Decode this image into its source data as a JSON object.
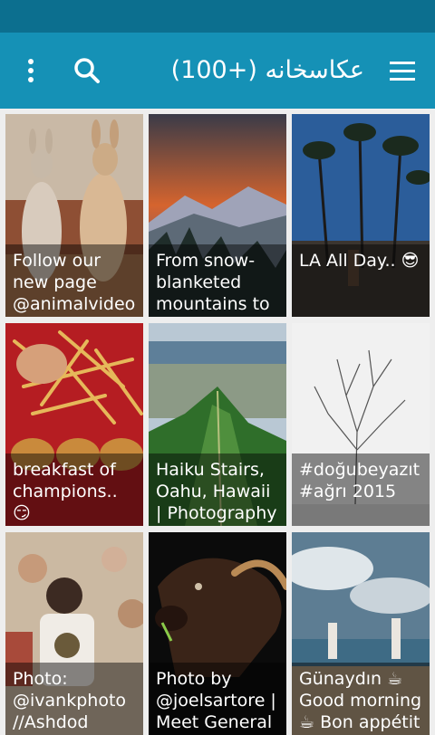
{
  "header": {
    "title": "عکاسخانه (+100)",
    "menu_icon": "hamburger-menu-icon",
    "search_icon": "search-icon",
    "overflow_icon": "overflow-menu-icon"
  },
  "colors": {
    "status_bar": "#0c6f8f",
    "app_bar": "#1591b6",
    "background": "#eeeeee"
  },
  "posts": [
    {
      "caption": "Follow our new page @animalvideo"
    },
    {
      "caption": "From snow-blanketed mountains to"
    },
    {
      "caption": "LA All Day.. 😎"
    },
    {
      "caption": "breakfast of champions.. 😏"
    },
    {
      "caption": "Haiku Stairs, Oahu, Hawaii | Photography"
    },
    {
      "caption": "#doğubeyazıt #ağrı 2015"
    },
    {
      "caption": "Photo: @ivankphoto //Ashdod"
    },
    {
      "caption": "Photo by @joelsartore | Meet General"
    },
    {
      "caption": "Günaydın ☕ Good morning ☕ Bon appétit"
    }
  ]
}
